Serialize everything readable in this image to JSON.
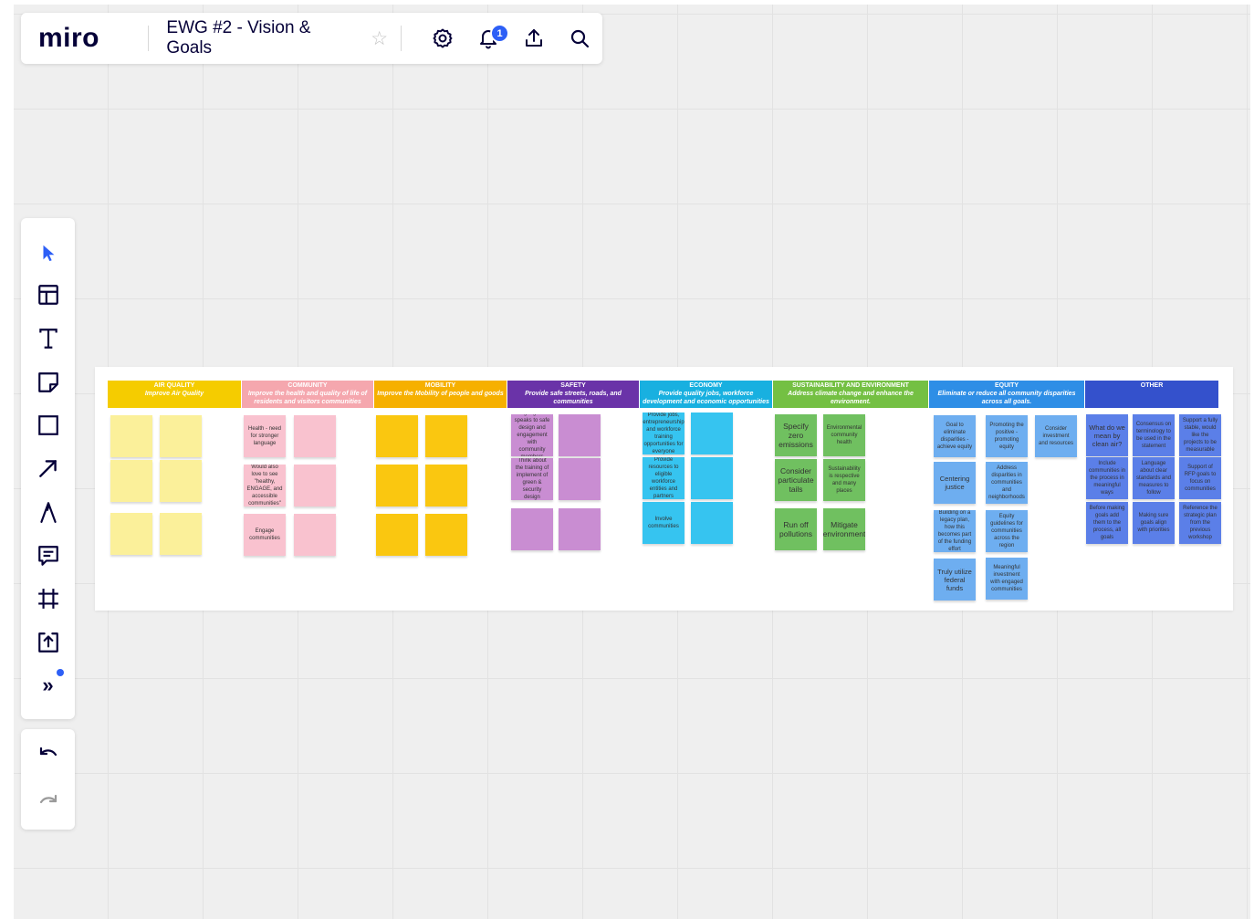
{
  "app": {
    "logo": "miro"
  },
  "topbar": {
    "board_title": "EWG #2 - Vision & Goals",
    "star_icon": "☆",
    "notification_count": "1",
    "icons": [
      "settings-icon",
      "bell-icon",
      "upload-icon",
      "search-icon"
    ]
  },
  "toolbar": {
    "tools": [
      "select-tool",
      "templates-tool",
      "text-tool",
      "sticky-note-tool",
      "shape-tool",
      "arrow-tool",
      "pen-tool",
      "comment-tool",
      "frame-tool",
      "upload-tool",
      "more-tools"
    ],
    "more_label": "»",
    "undo_icon": "undo-icon",
    "redo_icon": "redo-icon"
  },
  "colors": {
    "accent": "#2d5ff6",
    "air_quality": "#f5d000",
    "community": "#f4a8b0",
    "mobility": "#f7b500",
    "safety": "#6f31a8",
    "economy": "#1ab2e0",
    "sustainability": "#79c24a",
    "equity": "#2e8ee0",
    "other": "#2f4fcc"
  },
  "board": {
    "columns": [
      {
        "title": "AIR QUALITY",
        "subtitle": "Improve Air Quality",
        "header_color": "#f5cc00",
        "note_color": "#fbf09a",
        "notes": [
          "",
          "",
          "",
          "",
          "",
          ""
        ]
      },
      {
        "title": "COMMUNITY",
        "subtitle": "Improve the health and quality of life of residents and visitors communities",
        "header_color": "#f5a7ae",
        "note_color": "#f9c2cf",
        "notes": [
          "Health - need for stronger language",
          "",
          "Would also love to see \"healthy, ENGAGE, and accessible communities\"",
          "",
          "Engage communities",
          ""
        ]
      },
      {
        "title": "MOBILITY",
        "subtitle": "Improve the Mobility of people and goods",
        "header_color": "#f6b000",
        "note_color": "#fac710",
        "notes": [
          "",
          "",
          "",
          "",
          "",
          ""
        ]
      },
      {
        "title": "SAFETY",
        "subtitle": "Provide safe streets, roads, and communities",
        "header_color": "#6a33a8",
        "note_color": "#c98dd2",
        "notes": [
          "Language that speaks to safe design and engagement with community members",
          "",
          "Think about the training of implement of green & security design",
          "",
          "",
          ""
        ]
      },
      {
        "title": "ECONOMY",
        "subtitle": "Provide quality jobs, workforce development and economic opportunities",
        "header_color": "#18b0e0",
        "note_color": "#36c4f0",
        "notes": [
          "Provide jobs, entrepreneurship and workforce training opportunities for everyone",
          "",
          "Provide resources to eligible workforce entities and partners",
          "",
          "Involve communities",
          ""
        ]
      },
      {
        "title": "SUSTAINABILITY AND ENVIRONMENT",
        "subtitle": "Address climate change and enhance the environment.",
        "header_color": "#74c043",
        "note_color": "#70c060",
        "notes": [
          "Specify zero emissions",
          "Environmental community health",
          "Consider particulate tails",
          "Sustainability is respective and many places",
          "Run off pollutions",
          "Mitigate environment"
        ]
      },
      {
        "title": "EQUITY",
        "subtitle": "Eliminate or reduce all community disparities across all goals.",
        "header_color": "#2e8ee6",
        "note_color": "#6eaef0",
        "notes": [
          "Goal to eliminate disparities - achieve equity",
          "Promoting the positive - promoting equity",
          "Consider investment and resources",
          "Centering justice",
          "Address disparities in communities and neighborhoods",
          "",
          "Building on a legacy plan, how this becomes part of the funding effort",
          "Equity guidelines for communities across the region",
          "",
          "Truly utilize federal funds",
          "Meaningful investment with engaged communities",
          ""
        ]
      },
      {
        "title": "OTHER",
        "subtitle": "",
        "header_color": "#3451cc",
        "note_color": "#5b7fe8",
        "notes": [
          "What do we mean by clean air?",
          "Consensus on terminology to be used in the statement",
          "Support a fully stable, would like the projects to be measurable",
          "Include communities in the process in meaningful ways",
          "Language about clear standards and measures to follow",
          "Support of RFP goals to focus on communities",
          "Before making goals add them to the process, all goals",
          "Making sure goals align with priorities",
          "Reference the strategic plan from the previous workshop"
        ]
      }
    ]
  }
}
